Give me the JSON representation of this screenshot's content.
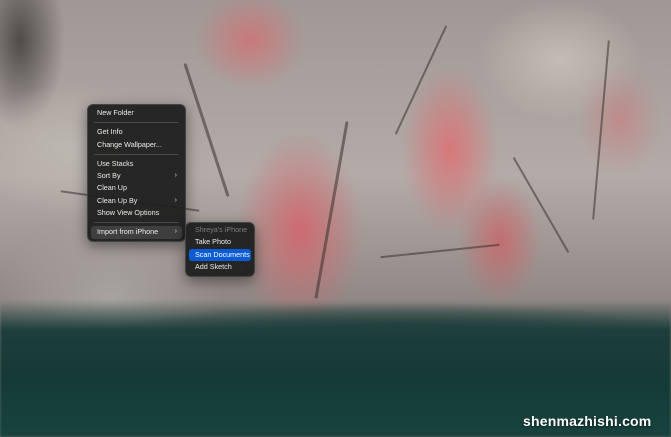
{
  "context_menu": {
    "groups": [
      [
        {
          "label": "New Folder"
        }
      ],
      [
        {
          "label": "Get Info"
        },
        {
          "label": "Change Wallpaper..."
        }
      ],
      [
        {
          "label": "Use Stacks"
        },
        {
          "label": "Sort By",
          "arrow": "›"
        },
        {
          "label": "Clean Up"
        },
        {
          "label": "Clean Up By",
          "arrow": "›"
        },
        {
          "label": "Show View Options"
        }
      ],
      [
        {
          "label": "Import from iPhone",
          "arrow": "›"
        }
      ]
    ]
  },
  "submenu": {
    "header": "Shreya's iPhone",
    "items": [
      {
        "label": "Take Photo"
      },
      {
        "label": "Scan Documents"
      },
      {
        "label": "Add Sketch"
      }
    ]
  },
  "watermark": "shenmazhishi.com",
  "colors": {
    "menu_bg": "#1e1e1e",
    "highlight_blue": "#0a5bd6",
    "menu_text": "#ececec",
    "disabled_text": "#7d7d7d"
  }
}
